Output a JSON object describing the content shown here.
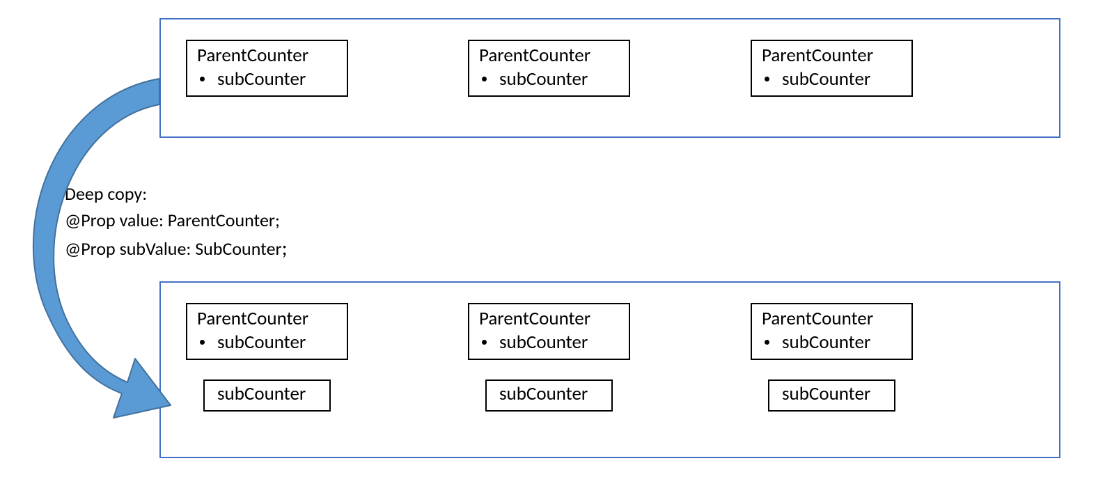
{
  "labels": {
    "line1": "Deep copy:",
    "line2": "@Prop value: ParentCounter;",
    "line3_a": "@Prop subValue: SubCounter",
    "line3_b": ";"
  },
  "boxes": {
    "parent_title": "ParentCounter",
    "sub_bullet": "subCounter",
    "sub_standalone": "subCounter"
  },
  "colors": {
    "container_border": "#4472C4",
    "arrow_fill": "#5B9BD5",
    "arrow_stroke": "#41719C"
  }
}
